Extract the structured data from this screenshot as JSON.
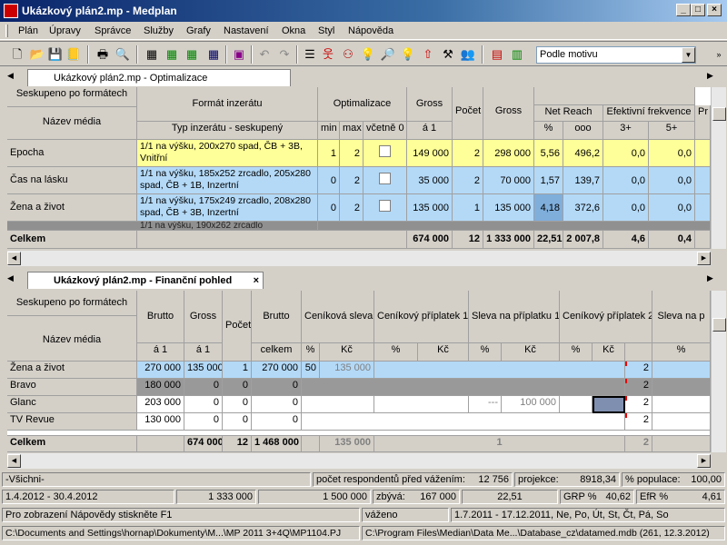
{
  "window": {
    "title": "Ukázkový plán2.mp - Medplan"
  },
  "menu": [
    "Plán",
    "Úpravy",
    "Správce",
    "Služby",
    "Grafy",
    "Nastavení",
    "Okna",
    "Styl",
    "Nápověda"
  ],
  "toolbar": {
    "combo_value": "Podle motivu"
  },
  "opt_tab": {
    "label": "Ukázkový plán2.mp - Optimalizace"
  },
  "fin_tab": {
    "label": "Ukázkový plán2.mp - Finanční pohled"
  },
  "opt": {
    "h_group": "Seskupeno po formátech",
    "h_name": "Název média",
    "h_format": "Formát inzerátu",
    "h_type": "Typ inzerátu - seskupený",
    "h_optim": "Optimalizace",
    "h_min": "min",
    "h_max": "max",
    "h_incl": "včetně 0",
    "h_gross": "Gross",
    "h_a1": "á 1",
    "h_count": "Počet",
    "h_gross2": "Gross",
    "h_netreach": "Net Reach",
    "h_pct": "%",
    "h_ooo": "ooo",
    "h_efreq": "Efektivní frekvence",
    "h_3p": "3+",
    "h_5p": "5+",
    "h_pr": "Pr",
    "rows": [
      {
        "name": "Epocha",
        "type": "1/1 na výšku, 200x270 spad, ČB + 3B, Vnitřní",
        "min": "1",
        "max": "2",
        "gross": "149 000",
        "count": "2",
        "gross2": "298 000",
        "pct": "5,56",
        "ooo": "496,2",
        "f3": "0,0",
        "f5": "0,0"
      },
      {
        "name": "Čas na lásku",
        "type": "1/1 na výšku, 185x252 zrcadlo, 205x280 spad, ČB + 1B, Inzertní",
        "min": "0",
        "max": "2",
        "gross": "35 000",
        "count": "2",
        "gross2": "70 000",
        "pct": "1,57",
        "ooo": "139,7",
        "f3": "0,0",
        "f5": "0,0"
      },
      {
        "name": "Žena a život",
        "type": "1/1 na výšku, 175x249 zrcadlo, 208x280 spad, ČB + 3B, Inzertní",
        "min": "0",
        "max": "2",
        "gross": "135 000",
        "count": "1",
        "gross2": "135 000",
        "pct": "4,18",
        "ooo": "372,6",
        "f3": "0,0",
        "f5": "0,0"
      }
    ],
    "partial_type": "1/1 na výšku, 190x262 zrcadlo",
    "total": {
      "label": "Celkem",
      "gross": "674 000",
      "count": "12",
      "gross2": "1 333 000",
      "pct": "22,51",
      "ooo": "2 007,8",
      "f3": "4,6",
      "f5": "0,4"
    }
  },
  "fin": {
    "h_group": "Seskupeno po formátech",
    "h_name": "Název média",
    "h_brutto": "Brutto",
    "h_a1": "á 1",
    "h_gross": "Gross",
    "h_count": "Počet",
    "h_brutto2": "Brutto",
    "h_celkem": "celkem",
    "h_discount": "Ceníková sleva",
    "h_pct": "%",
    "h_kc": "Kč",
    "h_sur1": "Ceníkový příplatek 1",
    "h_disc1": "Sleva na příplatku 1",
    "h_sur2": "Ceníkový příplatek 2",
    "h_disc2": "Sleva na p",
    "rows": [
      {
        "name": "Žena a život",
        "brutto": "270 000",
        "gross": "135 000",
        "count": "1",
        "total": "270 000",
        "dpct": "50",
        "dkc": "135 000",
        "s2": "2"
      },
      {
        "name": "Bravo",
        "brutto": "180 000",
        "gross": "0",
        "count": "0",
        "total": "0",
        "dpct": "",
        "dkc": "",
        "s2": "2"
      },
      {
        "name": "Glanc",
        "brutto": "203 000",
        "gross": "0",
        "count": "0",
        "total": "0",
        "dpct": "",
        "dkc": "",
        "s2": "2",
        "d1pct": "---",
        "d1kc": "100 000"
      },
      {
        "name": "TV Revue",
        "brutto": "130 000",
        "gross": "0",
        "count": "0",
        "total": "0",
        "dpct": "",
        "dkc": "",
        "s2": "2"
      }
    ],
    "total": {
      "label": "Celkem",
      "gross": "674 000",
      "count": "12",
      "total": "1 468 000",
      "dkc": "135 000",
      "d1": "1",
      "s2": "2"
    }
  },
  "status": {
    "filter": "-Všichni-",
    "resp_label": "počet respondentů před vážením:",
    "resp_value": "12 756",
    "proj_label": "projekce:",
    "proj_value": "8918,34",
    "popul_label": "% populace:",
    "popul_value": "100,00",
    "period": "1.4.2012 - 30.4.2012",
    "v1": "1 333 000",
    "v2": "1 500 000",
    "remain_label": "zbývá:",
    "remain_value": "167 000",
    "v3": "22,51",
    "grp_label": "GRP %",
    "grp_value": "40,62",
    "efr_label": "EfR %",
    "efr_value": "4,61",
    "help": "Pro zobrazení Nápovědy stiskněte F1",
    "weighted": "váženo",
    "dates": "1.7.2011 - 17.12.2011, Ne, Po, Út, St, Čt, Pá, So",
    "path1": "C:\\Documents and Settings\\hornap\\Dokumenty\\M...\\MP 2011 3+4Q\\MP1104.PJ",
    "path2": "C:\\Program Files\\Median\\Data Me...\\Database_cz\\datamed.mdb (261, 12.3.2012)"
  }
}
